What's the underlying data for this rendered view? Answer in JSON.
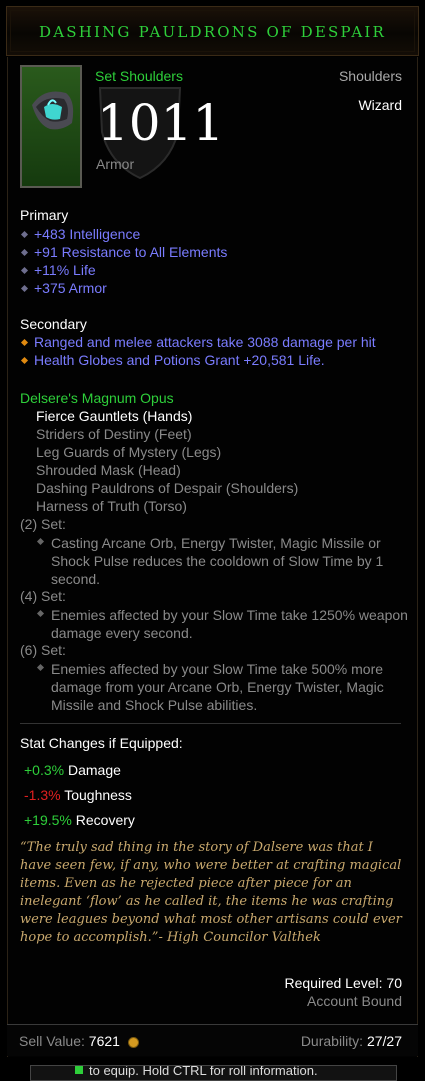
{
  "item": {
    "name": "DASHING PAULDRONS OF DESPAIR",
    "type": "Set Shoulders",
    "slot": "Shoulders",
    "class": "Wizard",
    "armor_value": "1011",
    "armor_label": "Armor"
  },
  "primary": {
    "title": "Primary",
    "stats": [
      "+483 Intelligence",
      "+91 Resistance to All Elements",
      "+11% Life",
      "+375 Armor"
    ]
  },
  "secondary": {
    "title": "Secondary",
    "stats": [
      "Ranged and melee attackers take 3088 damage per hit",
      "Health Globes and Potions Grant +20,581 Life."
    ]
  },
  "set": {
    "name": "Delsere's Magnum Opus",
    "pieces": [
      "Fierce Gauntlets (Hands)",
      "Striders of Destiny (Feet)",
      "Leg Guards of Mystery (Legs)",
      "Shrouded Mask (Head)",
      "Dashing Pauldrons of Despair (Shoulders)",
      "Harness of Truth (Torso)"
    ],
    "bonuses": [
      {
        "label": "(2) Set:",
        "text": "Casting Arcane Orb, Energy Twister, Magic Missile or Shock Pulse reduces the cooldown of Slow Time by 1 second."
      },
      {
        "label": "(4) Set:",
        "text": "Enemies affected by your Slow Time take 1250% weapon damage every second."
      },
      {
        "label": "(6) Set:",
        "text": "Enemies affected by your Slow Time take 500% more damage from your Arcane Orb, Energy Twister, Magic Missile and Shock Pulse abilities."
      }
    ]
  },
  "stat_changes": {
    "title": "Stat Changes if Equipped:",
    "rows": [
      {
        "value": "+0.3%",
        "label": "Damage",
        "color": "#2ecf3a"
      },
      {
        "value": "-1.3%",
        "label": "Toughness",
        "color": "#e02020"
      },
      {
        "value": "+19.5%",
        "label": "Recovery",
        "color": "#2ecf3a"
      }
    ]
  },
  "flavor_text": "“The truly sad thing in the story of Dalsere was that I have seen few, if any, who were better at crafting magical items. Even as he rejected piece after piece for an inelegant ‘flow’ as he called it, the items he was crafting were leagues beyond what most other artisans could ever hope to accomplish.”- High Councilor Valthek",
  "requirements": {
    "required_level": "Required Level: 70",
    "account_bound": "Account Bound"
  },
  "footer": {
    "sell_label": "Sell Value:",
    "sell_value": "7621",
    "durability_label": "Durability:",
    "durability_value": "27/27"
  },
  "hint_bar": "to equip. Hold CTRL for roll information.",
  "icons": {
    "currency": "gold-coin-icon",
    "bullet": "diamond-bullet-icon",
    "bullet_orange": "orange-diamond-bullet-icon"
  }
}
